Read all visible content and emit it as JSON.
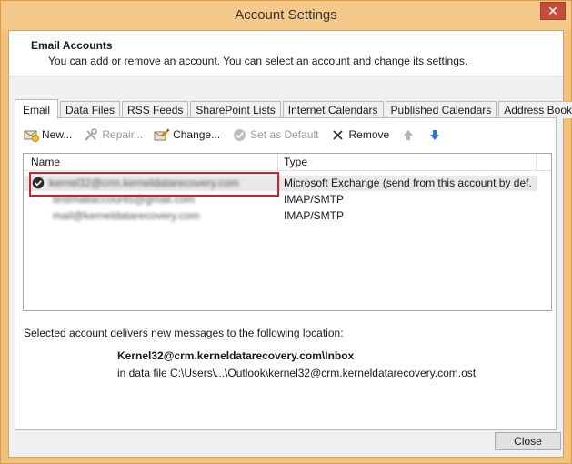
{
  "window": {
    "title": "Account Settings",
    "close_glyph": "✕"
  },
  "header": {
    "title": "Email Accounts",
    "description": "You can add or remove an account. You can select an account and change its settings."
  },
  "tabs": [
    {
      "label": "Email",
      "active": true
    },
    {
      "label": "Data Files"
    },
    {
      "label": "RSS Feeds"
    },
    {
      "label": "SharePoint Lists"
    },
    {
      "label": "Internet Calendars"
    },
    {
      "label": "Published Calendars"
    },
    {
      "label": "Address Books"
    }
  ],
  "toolbar": {
    "new": {
      "label": "New...",
      "icon": "new-account-icon"
    },
    "repair": {
      "label": "Repair...",
      "icon": "repair-tools-icon"
    },
    "change": {
      "label": "Change...",
      "icon": "change-icon"
    },
    "set_default": {
      "label": "Set as Default",
      "icon": "check-circle-icon"
    },
    "remove": {
      "label": "Remove",
      "icon": "x-icon"
    },
    "move_up": {
      "icon": "arrow-up-icon"
    },
    "move_down": {
      "icon": "arrow-down-icon"
    }
  },
  "accounts_list": {
    "columns": [
      "Name",
      "Type"
    ],
    "rows": [
      {
        "name": "kernel32@crm.kerneldatarecovery.com",
        "type": "Microsoft Exchange (send from this account by def...",
        "default": true
      },
      {
        "name": "testmailaccounts@gmail.com",
        "type": "IMAP/SMTP"
      },
      {
        "name": "mail@kerneldatarecovery.com",
        "type": "IMAP/SMTP"
      }
    ]
  },
  "delivery": {
    "intro": "Selected account delivers new messages to the following location:",
    "path": "Kernel32@crm.kerneldatarecovery.com\\Inbox",
    "file": "in data file C:\\Users\\...\\Outlook\\kernel32@crm.kerneldatarecovery.com.ost"
  },
  "buttons": {
    "close": "Close"
  },
  "colors": {
    "frame": "#f5c98a",
    "highlight": "#d2202a",
    "close_window": "#c74b3c"
  }
}
